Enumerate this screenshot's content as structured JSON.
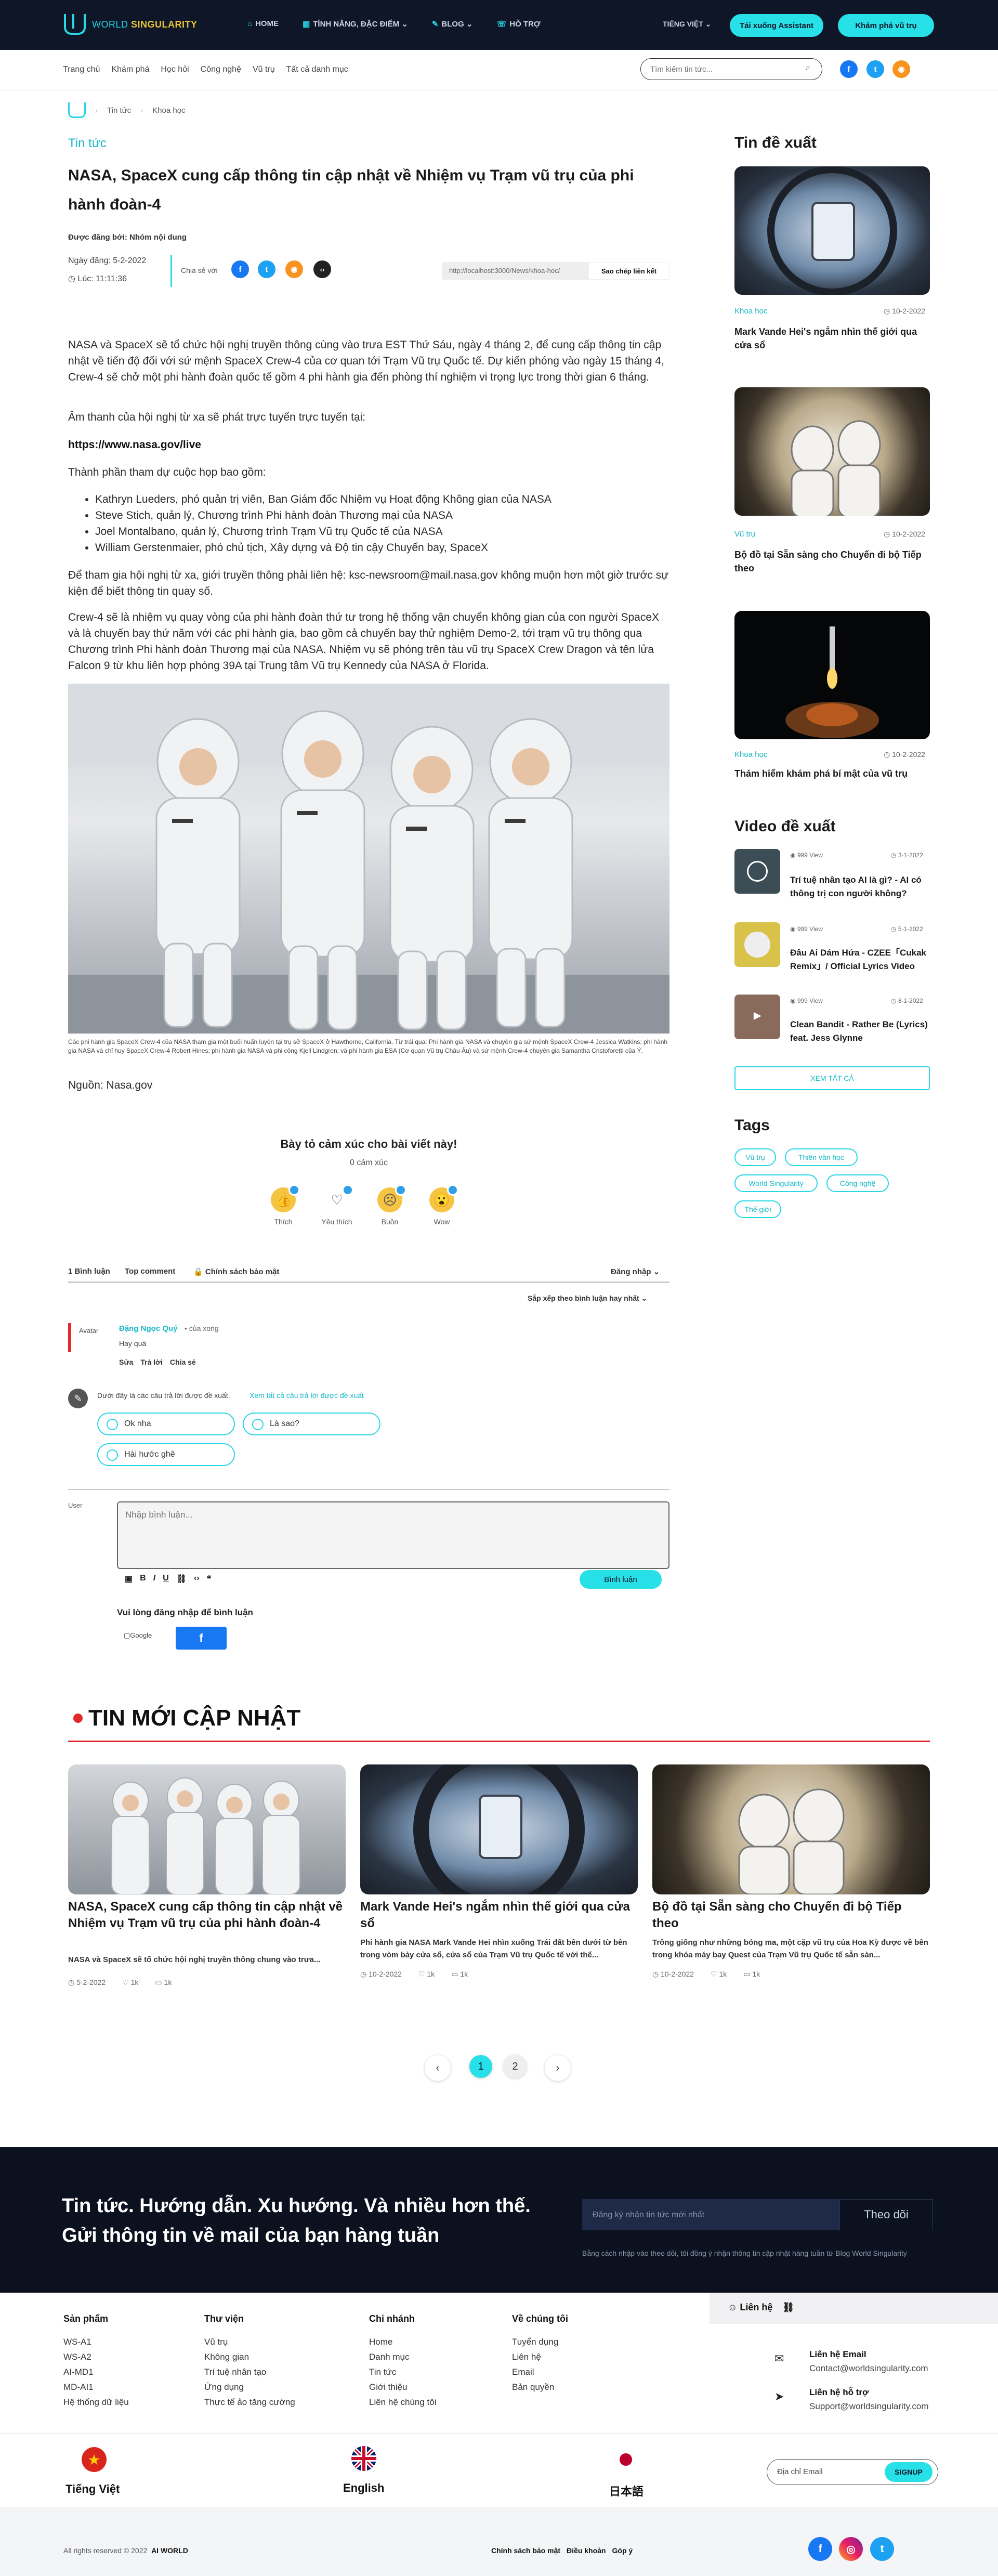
{
  "header": {
    "logo_world": "WORLD",
    "logo_singularity": "SINGULARITY",
    "nav": [
      "HOME",
      "TÍNH NĂNG, ĐẶC ĐIỂM",
      "BLOG",
      "HỖ TRỢ"
    ],
    "language": "TIẾNG VIỆT",
    "download_btn": "Tải xuống Assistant",
    "try_btn": "Khám phá vũ trụ"
  },
  "subnav": {
    "links": [
      "Trang chủ",
      "Khám phá",
      "Học hỏi",
      "Công nghệ",
      "Vũ trụ",
      "Tất cả danh mục"
    ],
    "search_placeholder": "Tìm kiếm tin tức..."
  },
  "breadcrumb": [
    "Tin tức",
    "Khoa học"
  ],
  "article": {
    "category": "Tin tức",
    "title": "NASA, SpaceX cung cấp thông tin cập nhật về Nhiệm vụ Trạm vũ trụ của phi hành đoàn-4",
    "posted_by": "Được đăng bởi: Nhóm nội dung",
    "date": "Ngày đăng: 5-2-2022",
    "time": "Lúc: 11:11:36",
    "share_label": "Chia sẻ với",
    "link": "http://localhost:3000/News/khoa-hoc/",
    "copy_btn": "Sao chép liên kết",
    "p1": "NASA và SpaceX sẽ tổ chức hội nghị truyền thông cùng vào trưa EST Thứ Sáu, ngày 4 tháng 2, để cung cấp thông tin cập nhật về tiến độ đối với sứ mệnh SpaceX Crew-4 của cơ quan tới Trạm Vũ trụ Quốc tế. Dự kiến phóng vào ngày 15 tháng 4, Crew-4 sẽ chở một phi hành đoàn quốc tế gồm 4 phi hành gia đến phòng thí nghiệm vi trọng lực trong thời gian 6 tháng.",
    "p2": "Âm thanh của hội nghị từ xa sẽ phát trực tuyến trực tuyến tại:",
    "p3": "https://www.nasa.gov/live",
    "p4": "Thành phần tham dự cuộc họp bao gồm:",
    "bullets": [
      "Kathryn Lueders, phó quản trị viên, Ban Giám đốc Nhiệm vụ Hoạt động Không gian của NASA",
      "Steve Stich, quản lý, Chương trình Phi hành đoàn Thương mại của NASA",
      "Joel Montalbano, quản lý, Chương trình Trạm Vũ trụ Quốc tế của NASA",
      "William Gerstenmaier, phó chủ tịch, Xây dựng và Độ tin cậy Chuyến bay, SpaceX"
    ],
    "p5": "Để tham gia hội nghị từ xa, giới truyền thông phải liên hệ: ksc-newsroom@mail.nasa.gov không muộn hơn một giờ trước sự kiện để biết thông tin quay số.",
    "p6": "Crew-4 sẽ là nhiệm vụ quay vòng của phi hành đoàn thứ tư trong hệ thống vận chuyển không gian của con người SpaceX và là chuyến bay thứ năm với các phi hành gia, bao gồm cả chuyến bay thử nghiệm Demo-2, tới trạm vũ trụ thông qua Chương trình Phi hành đoàn Thương mại của NASA. Nhiệm vụ sẽ phóng trên tàu vũ trụ SpaceX Crew Dragon và tên lửa Falcon 9 từ khu liên hợp phóng 39A tại Trung tâm Vũ trụ Kennedy của NASA ở Florida.",
    "caption": "Các phi hành gia SpaceX Crew-4 của NASA tham gia một buổi huấn luyện tại trụ sở SpaceX ở Hawthorne, California. Từ trái qua: Phi hành gia NASA và chuyên gia sứ mệnh SpaceX Crew-4 Jessica Watkins; phi hành gia NASA và chỉ huy SpaceX Crew-4 Robert Hines; phi hành gia NASA và phi công Kjell Lindgren; và phi hành gia ESA (Cơ quan Vũ trụ Châu Âu) và sứ mệnh Crew-4 chuyên gia Samantha Cristoforetti của Ý.",
    "source": "Nguồn: Nasa.gov"
  },
  "reactions": {
    "title": "Bày tỏ cảm xúc cho bài viết này!",
    "count": "0 cảm xúc",
    "items": [
      "Thích",
      "Yêu thích",
      "Buồn",
      "Wow"
    ]
  },
  "comments": {
    "count": "1 Bình luận",
    "top": "Top comment",
    "policy": "Chính sách bảo mật",
    "login": "Đăng nhập",
    "sort": "Sắp xếp theo bình luận hay nhất",
    "author": "Đặng Ngọc Quý",
    "author_role": "của xong",
    "avatar_alt": "Avatar",
    "text": "Hay quá",
    "actions": [
      "Sửa",
      "Trả lời",
      "Chia sẻ"
    ],
    "suggest": "Dưới đây là các câu trả lời được đề xuất.",
    "suggest_link": "Xem tất cả câu trả lời được đề xuất",
    "options": [
      "Ok nha",
      "Là sao?",
      "Hài hước ghê"
    ],
    "user_alt": "User",
    "input_placeholder": "Nhập bình luận...",
    "submit": "Bình luận",
    "login_prompt": "Vui lòng đăng nhập để bình luận",
    "google": "Google"
  },
  "sidebar": {
    "featured_title": "Tin đề xuất",
    "featured": [
      {
        "cat": "Khoa học",
        "date": "10-2-2022",
        "title": "Mark Vande Hei's ngắm nhìn thế giới qua cửa sổ"
      },
      {
        "cat": "Vũ trụ",
        "date": "10-2-2022",
        "title": "Bộ đồ tại Sẵn sàng cho Chuyến đi bộ Tiếp theo"
      },
      {
        "cat": "Khoa học",
        "date": "10-2-2022",
        "title": "Thám hiểm khám phá bí mật của vũ trụ"
      }
    ],
    "video_title": "Video đề xuất",
    "videos": [
      {
        "views": "999 View",
        "date": "3-1-2022",
        "title": "Trí tuệ nhân tạo AI là gì? - AI có thông trị con người không?"
      },
      {
        "views": "999 View",
        "date": "5-1-2022",
        "title": "Đâu Ai Dám Hứa - CZEE「Cukak Remix」/ Official Lyrics Video"
      },
      {
        "views": "999 View",
        "date": "8-1-2022",
        "title": "Clean Bandit - Rather Be (Lyrics) feat. Jess Glynne"
      }
    ],
    "see_all": "XEM TẤT CẢ",
    "tags_title": "Tags",
    "tags": [
      "Vũ trụ",
      "Thiên văn học",
      "World Singularity",
      "Công nghệ",
      "Thế giới"
    ]
  },
  "latest": {
    "title": "TIN MỚI CẬP NHẬT",
    "cards": [
      {
        "title": "NASA, SpaceX cung cấp thông tin cập nhật về Nhiệm vụ Trạm vũ trụ của phi hành đoàn-4",
        "desc": "NASA và SpaceX sẽ tổ chức hội nghị truyền thông chung vào trưa...",
        "date": "5-2-2022",
        "likes": "1k",
        "comments": "1k"
      },
      {
        "title": "Mark Vande Hei's ngắm nhìn thế giới qua cửa sổ",
        "desc": "Phi hành gia NASA Mark Vande Hei nhìn xuống Trái đất bên dưới từ bên trong vòm bảy cửa sổ, cửa sổ của Trạm Vũ trụ Quốc tế với thế...",
        "date": "10-2-2022",
        "likes": "1k",
        "comments": "1k"
      },
      {
        "title": "Bộ đồ tại Sẵn sàng cho Chuyến đi bộ Tiếp theo",
        "desc": "Trông giống như những bóng ma, một cặp vũ trụ của Hoa Kỳ được về bên trong khóa máy bay Quest của Trạm Vũ trụ Quốc tế sẵn sàn...",
        "date": "10-2-2022",
        "likes": "1k",
        "comments": "1k"
      }
    ],
    "pages": [
      "1",
      "2"
    ]
  },
  "newsletter": {
    "line1": "Tin tức. Hướng dẫn. Xu hướng. Và nhiều hơn thế.",
    "line2": "Gửi thông tin về mail của bạn hàng tuần",
    "placeholder": "Đăng ký nhận tin tức mới nhất",
    "button": "Theo dõi",
    "note": "Bằng cách nhập vào theo dõi, tôi đồng ý nhận thông tin cập nhật hàng tuần từ Blog World Singularity"
  },
  "footer": {
    "cols": [
      {
        "title": "Sản phẩm",
        "items": [
          "WS-A1",
          "WS-A2",
          "AI-MD1",
          "MD-AI1",
          "Hệ thống dữ liệu"
        ]
      },
      {
        "title": "Thư viện",
        "items": [
          "Vũ trụ",
          "Không gian",
          "Trí tuệ nhân tạo",
          "Ứng dụng",
          "Thực tế ảo tăng cường"
        ]
      },
      {
        "title": "Chi nhánh",
        "items": [
          "Home",
          "Danh mục",
          "Tin tức",
          "Giới thiệu",
          "Liên hệ chúng tôi"
        ]
      },
      {
        "title": "Về chúng tôi",
        "items": [
          "Tuyển dụng",
          "Liên hệ",
          "Email",
          "Bản quyền"
        ]
      }
    ],
    "contact_title": "Liên hệ",
    "email_label": "Liên hệ Email",
    "email": "Contact@worldsingularity.com",
    "support_label": "Liên hệ hỗ trợ",
    "support": "Support@worldsingularity.com",
    "langs": [
      "Tiếng Việt",
      "English",
      "日本語"
    ],
    "sub_placeholder": "Địa chỉ Email",
    "sub_btn": "SIGNUP",
    "copyright": "All rights reserved © 2022",
    "brand": "AI WORLD",
    "bottom_links": [
      "Chính sách bảo mật",
      "Điều khoản",
      "Góp ý"
    ]
  }
}
